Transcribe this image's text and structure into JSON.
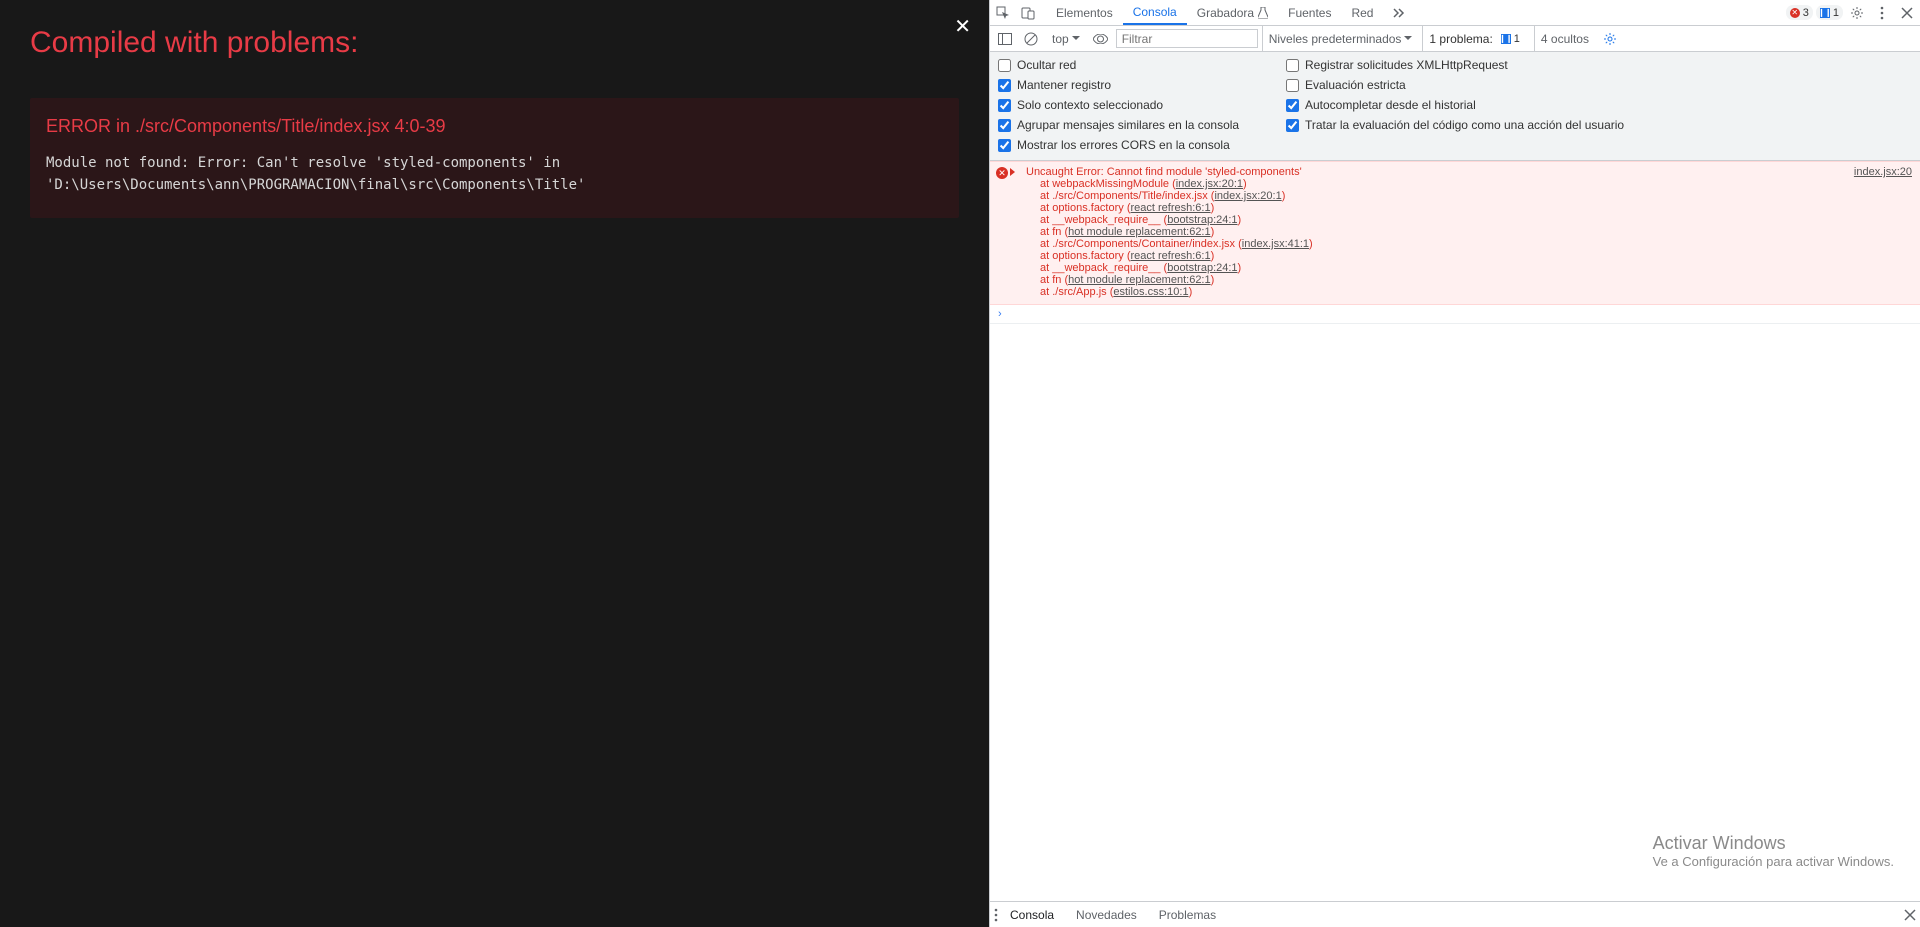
{
  "overlay": {
    "title": "Compiled with problems:",
    "close_glyph": "✕",
    "error": {
      "heading": "ERROR in ./src/Components/Title/index.jsx 4:0-39",
      "body": "Module not found: Error: Can't resolve 'styled-components' in\n'D:\\Users\\Documents\\ann\\PROGRAMACION\\final\\src\\Components\\Title'"
    }
  },
  "devtools": {
    "tabs": {
      "elements": "Elementos",
      "console": "Consola",
      "recorder": "Grabadora",
      "sources": "Fuentes",
      "network": "Red"
    },
    "top_badges": {
      "errors": "3",
      "info": "1"
    },
    "subbar": {
      "context": "top",
      "filter_placeholder": "Filtrar",
      "levels": "Niveles predeterminados",
      "issues_label": "1 problema:",
      "issues_count": "1",
      "hidden": "4 ocultos"
    },
    "settings": {
      "hide_network": "Ocultar red",
      "log_xhr": "Registrar solicitudes XMLHttpRequest",
      "preserve_log": "Mantener registro",
      "strict_eval": "Evaluación estricta",
      "selected_ctx": "Solo contexto seleccionado",
      "autocomplete_hist": "Autocompletar desde el historial",
      "group_similar": "Agrupar mensajes similares en la consola",
      "treat_eval_user": "Tratar la evaluación del código como una acción del usuario",
      "show_cors": "Mostrar los errores CORS en la consola"
    },
    "message": {
      "source_link": "index.jsx:20",
      "main": "Uncaught Error: Cannot find module 'styled-components'",
      "trace": [
        {
          "pre": "at webpackMissingModule (",
          "link": "index.jsx:20:1",
          "post": ")"
        },
        {
          "pre": "at ./src/Components/Title/index.jsx (",
          "link": "index.jsx:20:1",
          "post": ")"
        },
        {
          "pre": "at options.factory (",
          "link": "react refresh:6:1",
          "post": ")"
        },
        {
          "pre": "at __webpack_require__ (",
          "link": "bootstrap:24:1",
          "post": ")"
        },
        {
          "pre": "at fn (",
          "link": "hot module replacement:62:1",
          "post": ")"
        },
        {
          "pre": "at ./src/Components/Container/index.jsx (",
          "link": "index.jsx:41:1",
          "post": ")"
        },
        {
          "pre": "at options.factory (",
          "link": "react refresh:6:1",
          "post": ")"
        },
        {
          "pre": "at __webpack_require__ (",
          "link": "bootstrap:24:1",
          "post": ")"
        },
        {
          "pre": "at fn (",
          "link": "hot module replacement:62:1",
          "post": ")"
        },
        {
          "pre": "at ./src/App.js (",
          "link": "estilos.css:10:1",
          "post": ")"
        }
      ]
    },
    "drawer": {
      "console": "Consola",
      "whatsnew": "Novedades",
      "issues": "Problemas"
    }
  },
  "watermark": {
    "title": "Activar Windows",
    "sub": "Ve a Configuración para activar Windows."
  }
}
